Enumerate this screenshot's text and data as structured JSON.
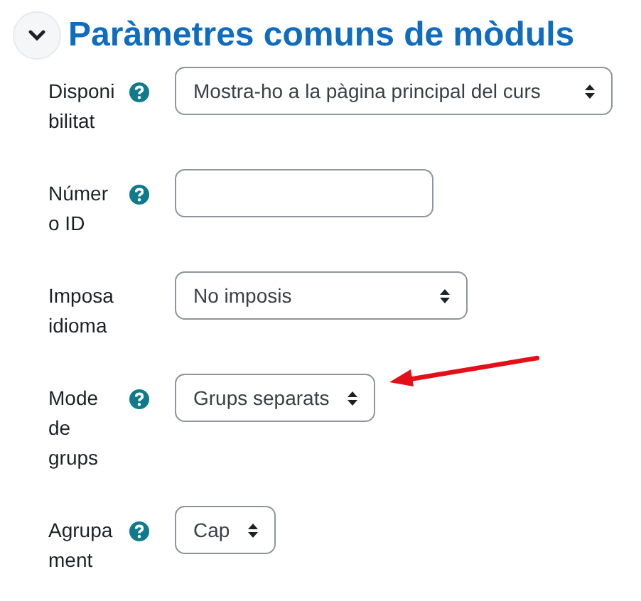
{
  "section": {
    "title": "Paràmetres comuns de mòduls",
    "expanded": true
  },
  "fields": [
    {
      "label_lines": [
        "Disponi",
        "bilitat"
      ],
      "help": true,
      "kind": "select",
      "value": "Mostra-ho a la pàgina principal del curs"
    },
    {
      "label_lines": [
        "Númer",
        "o ID"
      ],
      "help": true,
      "kind": "text"
    },
    {
      "label_lines": [
        "Imposa",
        "idioma"
      ],
      "help": false,
      "kind": "select",
      "value": "No imposis"
    },
    {
      "label_lines": [
        "Mode",
        "de",
        "grups"
      ],
      "help": true,
      "kind": "select",
      "value": "Grups separats"
    },
    {
      "label_lines": [
        "Agrupa",
        "ment"
      ],
      "help": true,
      "kind": "select",
      "value": "Cap"
    }
  ]
}
